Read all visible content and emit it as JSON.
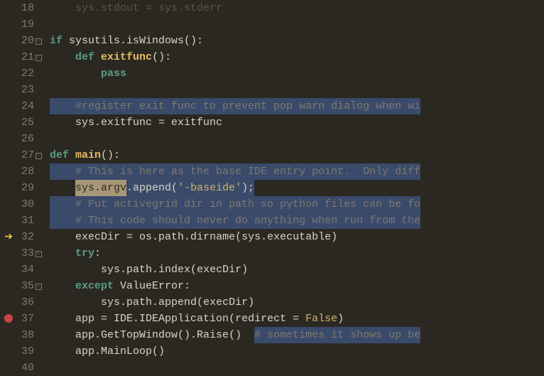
{
  "lines": [
    {
      "num": 18,
      "fold": "",
      "bp": "",
      "tokens": [
        [
          "plain",
          "    sys.stdout = sys.stderr"
        ]
      ],
      "faded": true
    },
    {
      "num": 19,
      "fold": "",
      "bp": "",
      "tokens": []
    },
    {
      "num": 20,
      "fold": "minus",
      "bp": "",
      "tokens": [
        [
          "kw",
          "if"
        ],
        [
          "plain",
          " sysutils.isWindows"
        ],
        [
          "punct",
          "():"
        ]
      ]
    },
    {
      "num": 21,
      "fold": "minus",
      "bp": "",
      "tokens": [
        [
          "plain",
          "    "
        ],
        [
          "kw",
          "def"
        ],
        [
          "plain",
          " "
        ],
        [
          "def",
          "exitfunc"
        ],
        [
          "punct",
          "():"
        ]
      ]
    },
    {
      "num": 22,
      "fold": "line",
      "bp": "",
      "tokens": [
        [
          "plain",
          "        "
        ],
        [
          "kw",
          "pass"
        ]
      ]
    },
    {
      "num": 23,
      "fold": "line",
      "bp": "",
      "tokens": []
    },
    {
      "num": 24,
      "fold": "line",
      "bp": "",
      "hl": true,
      "tokens": [
        [
          "plain",
          "    "
        ],
        [
          "comment-hl",
          "#register exit func to prevent pop warn dialog when wi"
        ]
      ]
    },
    {
      "num": 25,
      "fold": "end",
      "bp": "",
      "tokens": [
        [
          "plain",
          "    sys.exitfunc "
        ],
        [
          "punct",
          "="
        ],
        [
          "plain",
          " exitfunc"
        ]
      ]
    },
    {
      "num": 26,
      "fold": "",
      "bp": "",
      "tokens": []
    },
    {
      "num": 27,
      "fold": "minus",
      "bp": "",
      "tokens": [
        [
          "kw",
          "def"
        ],
        [
          "plain",
          " "
        ],
        [
          "def",
          "main"
        ],
        [
          "punct",
          "():"
        ]
      ]
    },
    {
      "num": 28,
      "fold": "line",
      "bp": "",
      "hl": true,
      "tokens": [
        [
          "plain",
          "    "
        ],
        [
          "comment-hl",
          "# This is here as the base IDE entry point.  Only diff"
        ]
      ]
    },
    {
      "num": 29,
      "fold": "line",
      "bp": "",
      "tokens": [
        [
          "plain",
          "    "
        ],
        [
          "search",
          "sys.argv"
        ],
        [
          "plain-hl",
          ".append"
        ],
        [
          "punct-hl",
          "("
        ],
        [
          "str-hl",
          "'-baseide'"
        ],
        [
          "punct-hl",
          ");"
        ]
      ]
    },
    {
      "num": 30,
      "fold": "line",
      "bp": "",
      "hl": true,
      "tokens": [
        [
          "plain",
          "    "
        ],
        [
          "comment-hl",
          "# Put activegrid dir in path so python files can be fo"
        ]
      ]
    },
    {
      "num": 31,
      "fold": "line",
      "bp": "",
      "hl": true,
      "tokens": [
        [
          "plain",
          "    "
        ],
        [
          "comment-hl",
          "# This code should never do anything when run from the"
        ]
      ]
    },
    {
      "num": 32,
      "fold": "line",
      "bp": "exec",
      "tokens": [
        [
          "plain",
          "    execDir "
        ],
        [
          "punct",
          "="
        ],
        [
          "plain",
          " os.path.dirname"
        ],
        [
          "punct",
          "("
        ],
        [
          "plain",
          "sys.executable"
        ],
        [
          "punct",
          ")"
        ]
      ]
    },
    {
      "num": 33,
      "fold": "minus",
      "bp": "",
      "tokens": [
        [
          "plain",
          "    "
        ],
        [
          "kw",
          "try"
        ],
        [
          "punct",
          ":"
        ]
      ]
    },
    {
      "num": 34,
      "fold": "line",
      "bp": "",
      "tokens": [
        [
          "plain",
          "        sys.path.index"
        ],
        [
          "punct",
          "("
        ],
        [
          "plain",
          "execDir"
        ],
        [
          "punct",
          ")"
        ]
      ]
    },
    {
      "num": 35,
      "fold": "minus",
      "bp": "",
      "tokens": [
        [
          "plain",
          "    "
        ],
        [
          "kw",
          "except"
        ],
        [
          "plain",
          " ValueError"
        ],
        [
          "punct",
          ":"
        ]
      ]
    },
    {
      "num": 36,
      "fold": "line",
      "bp": "",
      "tokens": [
        [
          "plain",
          "        sys.path.append"
        ],
        [
          "punct",
          "("
        ],
        [
          "plain",
          "execDir"
        ],
        [
          "punct",
          ")"
        ]
      ]
    },
    {
      "num": 37,
      "fold": "line",
      "bp": "bp",
      "tokens": [
        [
          "plain",
          "    app "
        ],
        [
          "punct",
          "="
        ],
        [
          "plain",
          " IDE.IDEApplication"
        ],
        [
          "punct",
          "("
        ],
        [
          "plain",
          "redirect "
        ],
        [
          "punct",
          "="
        ],
        [
          "plain",
          " "
        ],
        [
          "false",
          "False"
        ],
        [
          "punct",
          ")"
        ]
      ]
    },
    {
      "num": 38,
      "fold": "line",
      "bp": "",
      "tokens": [
        [
          "plain",
          "    app.GetTopWindow"
        ],
        [
          "punct",
          "()."
        ],
        [
          "plain",
          "Raise"
        ],
        [
          "punct",
          "()"
        ],
        [
          "plain",
          "  "
        ],
        [
          "comment-hl",
          "# sometimes it shows up be"
        ]
      ]
    },
    {
      "num": 39,
      "fold": "line",
      "bp": "",
      "tokens": [
        [
          "plain",
          "    app.MainLoop"
        ],
        [
          "punct",
          "()"
        ]
      ]
    },
    {
      "num": 40,
      "fold": "line",
      "bp": "",
      "tokens": []
    }
  ],
  "colors": {
    "bg": "#2b2822",
    "fg": "#d8d4c8",
    "keyword": "#5a9e89",
    "defname": "#e8be67",
    "string": "#d0b46a",
    "comment": "#7d7a6f",
    "highlight_bg": "#3a4a6a",
    "search_bg": "#a89878",
    "breakpoint": "#c94545",
    "exec_arrow": "#f0d040"
  }
}
